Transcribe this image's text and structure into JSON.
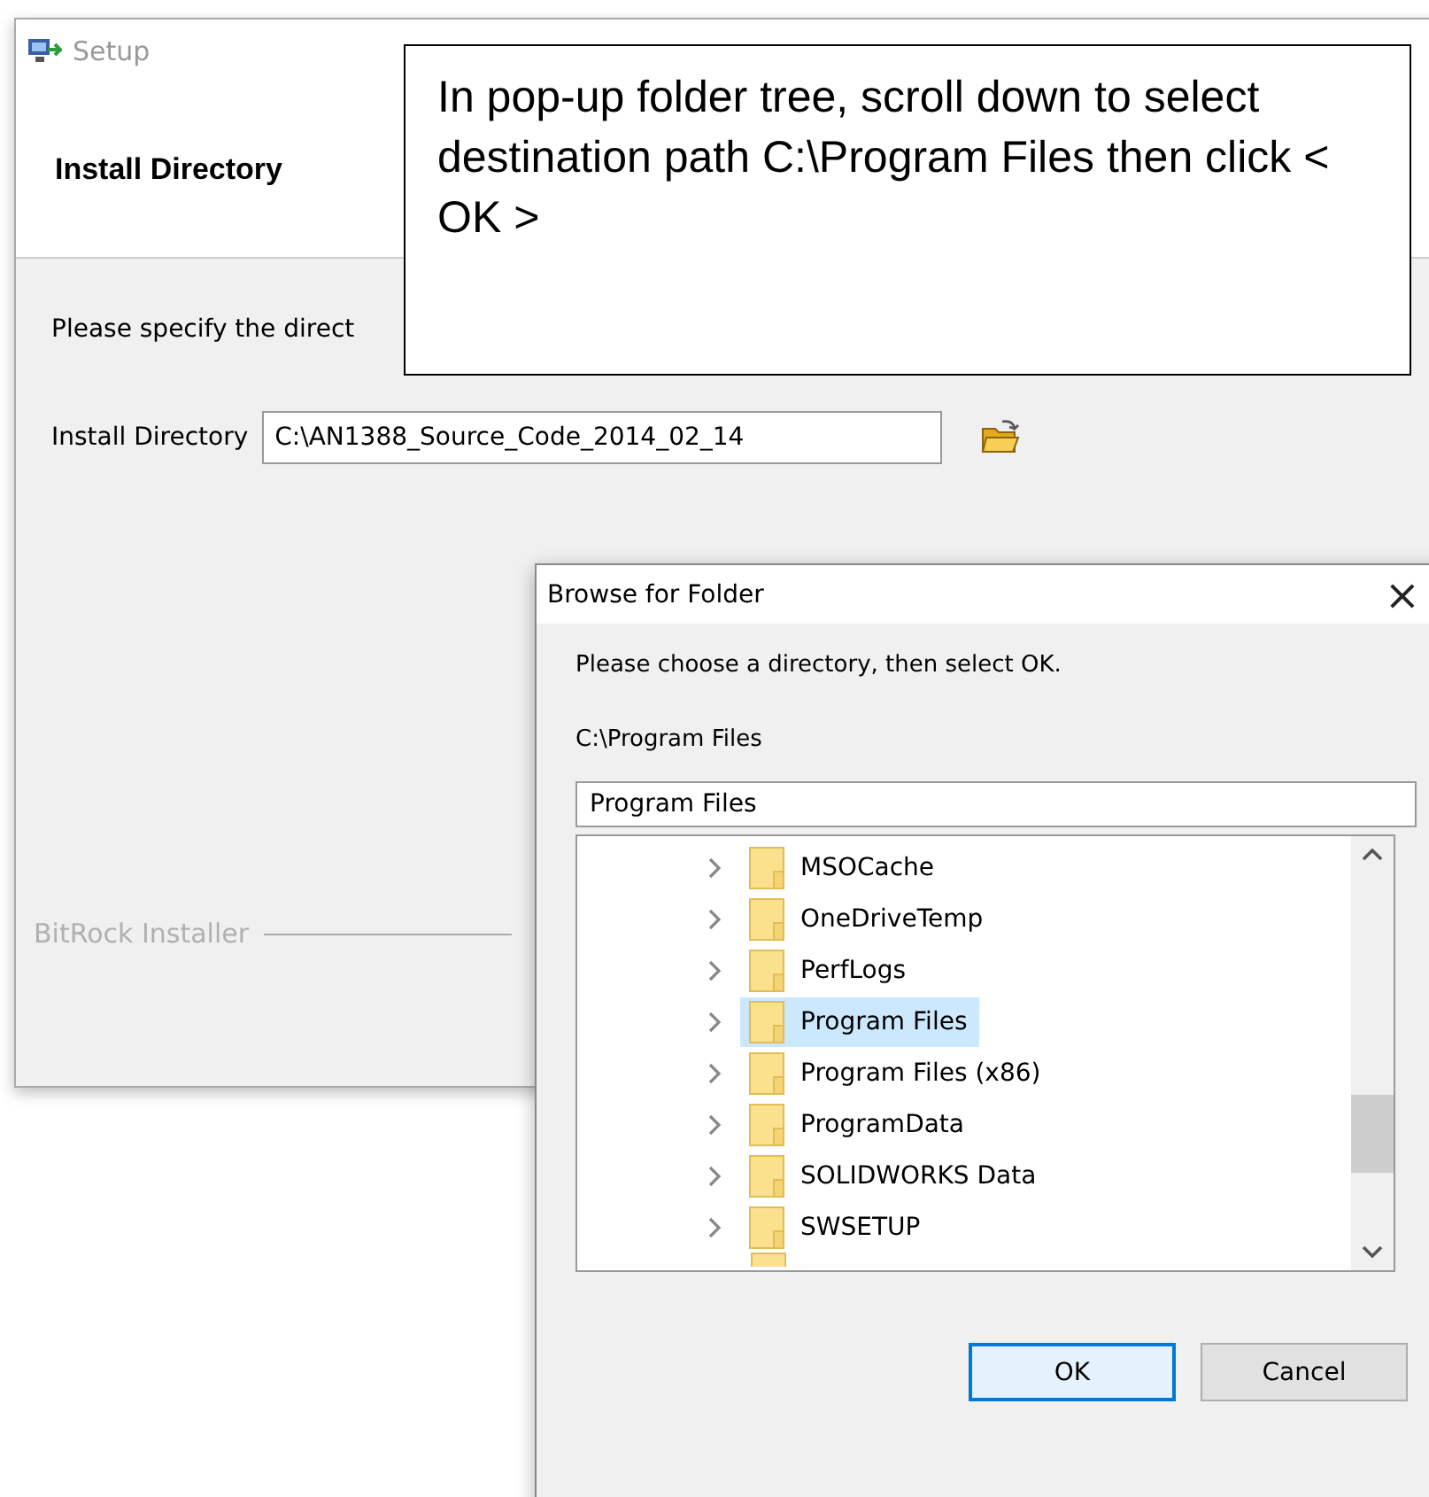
{
  "setup_window": {
    "title": "Setup",
    "header": "Install Directory",
    "prompt": "Please specify the direct",
    "field_label": "Install Directory",
    "field_value": "C:\\AN1388_Source_Code_2014_02_14",
    "footer": "BitRock Installer"
  },
  "browse_dialog": {
    "title": "Browse for Folder",
    "close": "×",
    "instruction": "Please choose a directory, then select OK.",
    "current_path": "C:\\Program Files",
    "folder_field": "Program Files",
    "tree": [
      {
        "name": "MSOCache",
        "selected": false
      },
      {
        "name": "OneDriveTemp",
        "selected": false
      },
      {
        "name": "PerfLogs",
        "selected": false
      },
      {
        "name": "Program Files",
        "selected": true
      },
      {
        "name": "Program Files (x86)",
        "selected": false
      },
      {
        "name": "ProgramData",
        "selected": false
      },
      {
        "name": "SOLIDWORKS Data",
        "selected": false
      },
      {
        "name": "SWSETUP",
        "selected": false
      }
    ],
    "buttons": [
      {
        "label": "OK",
        "kind": "default"
      },
      {
        "label": "Cancel",
        "kind": "normal"
      }
    ]
  },
  "callout": {
    "text": "In pop-up folder tree, scroll down to select destination path C:\\Program Files then click < OK >"
  }
}
